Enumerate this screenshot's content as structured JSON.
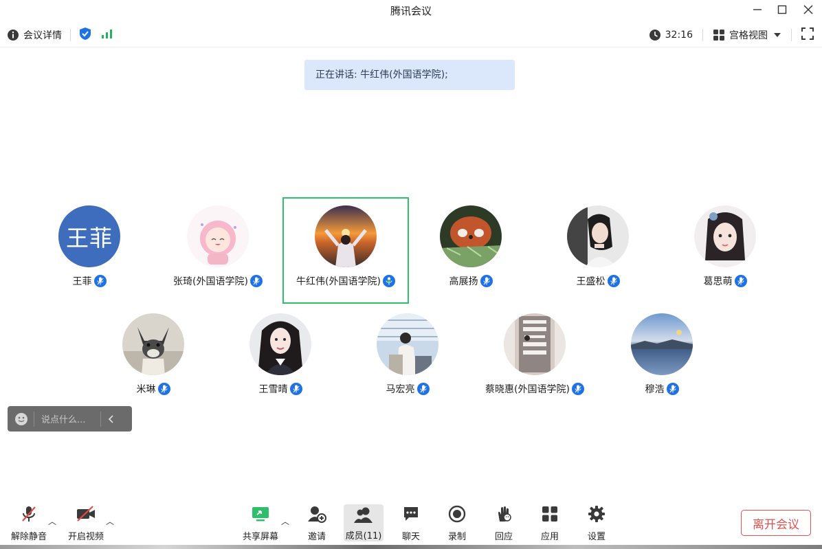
{
  "window": {
    "title": "腾讯会议"
  },
  "infobar": {
    "details_label": "会议详情",
    "timer": "32:16",
    "view_label": "宫格视图"
  },
  "banner": {
    "speaking_text": "正在讲话: 牛红伟(外国语学院);"
  },
  "participants": [
    {
      "name": "王菲",
      "avatar_text": "王菲"
    },
    {
      "name": "张琦(外国语学院)"
    },
    {
      "name": "牛红伟(外国语学院)"
    },
    {
      "name": "高展扬"
    },
    {
      "name": "王盛松"
    },
    {
      "name": "葛思萌"
    },
    {
      "name": "米琳"
    },
    {
      "name": "王雪晴"
    },
    {
      "name": "马宏亮"
    },
    {
      "name": "蔡晓惠(外国语学院)"
    },
    {
      "name": "穆浩"
    }
  ],
  "chat": {
    "placeholder": "说点什么..."
  },
  "toolbar": {
    "unmute": "解除静音",
    "video": "开启视频",
    "share": "共享屏幕",
    "invite": "邀请",
    "members": "成员(11)",
    "chat": "聊天",
    "record": "录制",
    "react": "回应",
    "apps": "应用",
    "settings": "设置",
    "leave": "离开会议"
  },
  "colors": {
    "accent": "#1f72e6",
    "active_border": "#2fbe6c",
    "leave": "#e0524e",
    "banner_bg": "#dbe8fb"
  }
}
